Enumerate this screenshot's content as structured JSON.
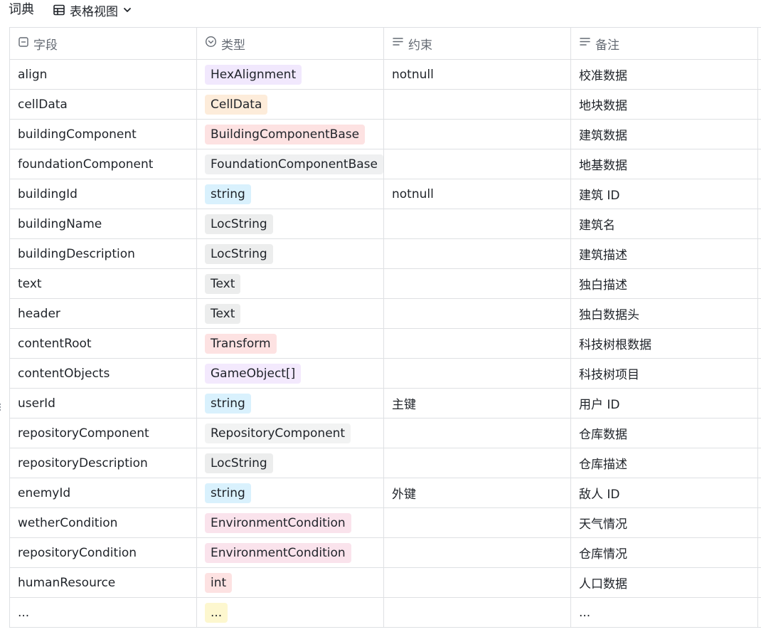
{
  "toolbar": {
    "title": "词典",
    "view_label": "表格视图",
    "view_icon": "grid-table-icon",
    "dropdown_icon": "chevron-down-icon"
  },
  "columns": [
    {
      "label": "字段",
      "icon": "text-field-icon"
    },
    {
      "label": "类型",
      "icon": "single-select-icon"
    },
    {
      "label": "约束",
      "icon": "multiline-text-icon"
    },
    {
      "label": "备注",
      "icon": "multiline-text-icon"
    }
  ],
  "tag_colors": {
    "purple": "#f1e8fd",
    "orange": "#fdecda",
    "red": "#fde2e2",
    "gray": "#eff0f1",
    "blue": "#d9f1fd",
    "pink": "#fce3ef",
    "yellow": "#fdf7cf"
  },
  "rows": [
    {
      "field": "align",
      "type": "HexAlignment",
      "type_color": "#f1e8fd",
      "constraint": "notnull",
      "note": "校准数据"
    },
    {
      "field": "cellData",
      "type": "CellData",
      "type_color": "#fdecda",
      "constraint": "",
      "note": "地块数据"
    },
    {
      "field": "buildingComponent",
      "type": "BuildingComponentBase",
      "type_color": "#fde2e2",
      "constraint": "",
      "note": "建筑数据"
    },
    {
      "field": "foundationComponent",
      "type": "FoundationComponentBase",
      "type_color": "#eff0f1",
      "constraint": "",
      "note": "地基数据"
    },
    {
      "field": "buildingId",
      "type": "string",
      "type_color": "#d9f1fd",
      "constraint": "notnull",
      "note": "建筑 ID"
    },
    {
      "field": "buildingName",
      "type": "LocString",
      "type_color": "#eceded",
      "constraint": "",
      "note": "建筑名"
    },
    {
      "field": "buildingDescription",
      "type": "LocString",
      "type_color": "#eceded",
      "constraint": "",
      "note": "建筑描述"
    },
    {
      "field": "text",
      "type": "Text",
      "type_color": "#eceded",
      "constraint": "",
      "note": "独白描述"
    },
    {
      "field": "header",
      "type": "Text",
      "type_color": "#eceded",
      "constraint": "",
      "note": "独白数据头"
    },
    {
      "field": "contentRoot",
      "type": "Transform",
      "type_color": "#fde2e2",
      "constraint": "",
      "note": "科技树根数据"
    },
    {
      "field": "contentObjects",
      "type": "GameObject[]",
      "type_color": "#f3e9fd",
      "constraint": "",
      "note": "科技树项目"
    },
    {
      "field": "userId",
      "type": "string",
      "type_color": "#d9f1fd",
      "constraint": "主键",
      "note": "用户 ID"
    },
    {
      "field": "repositoryComponent",
      "type": "RepositoryComponent",
      "type_color": "#f2f3f3",
      "constraint": "",
      "note": "仓库数据"
    },
    {
      "field": "repositoryDescription",
      "type": "LocString",
      "type_color": "#eceded",
      "constraint": "",
      "note": "仓库描述"
    },
    {
      "field": "enemyId",
      "type": "string",
      "type_color": "#d9f1fd",
      "constraint": "外键",
      "note": "敌人 ID"
    },
    {
      "field": "wetherCondition",
      "type": "EnvironmentCondition",
      "type_color": "#fae3ec",
      "constraint": "",
      "note": "天气情况"
    },
    {
      "field": "repositoryCondition",
      "type": "EnvironmentCondition",
      "type_color": "#fae3ec",
      "constraint": "",
      "note": "仓库情况"
    },
    {
      "field": "humanResource",
      "type": "int",
      "type_color": "#fde2e2",
      "constraint": "",
      "note": "人口数据"
    },
    {
      "field": "...",
      "type": "...",
      "type_color": "#fdf7cf",
      "constraint": "",
      "note": "..."
    }
  ]
}
